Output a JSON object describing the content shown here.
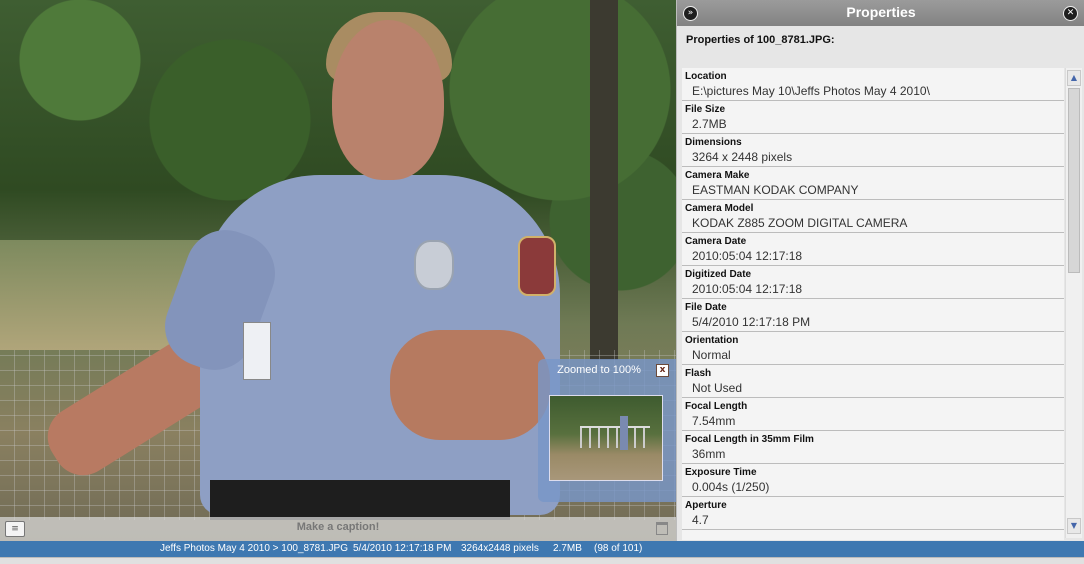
{
  "caption": {
    "placeholder": "Make a caption!"
  },
  "zoom": {
    "label": "Zoomed to 100%",
    "close": "x"
  },
  "panel": {
    "title": "Properties",
    "heading": "Properties of 100_8781.JPG:",
    "collapse_glyph": "»",
    "close_glyph": "✕",
    "properties": [
      {
        "label": "Location",
        "value": "E:\\pictures May 10\\Jeffs Photos May 4 2010\\"
      },
      {
        "label": "File Size",
        "value": "2.7MB"
      },
      {
        "label": "Dimensions",
        "value": "3264 x 2448 pixels"
      },
      {
        "label": "Camera Make",
        "value": "EASTMAN KODAK COMPANY"
      },
      {
        "label": "Camera Model",
        "value": "KODAK Z885 ZOOM DIGITAL CAMERA"
      },
      {
        "label": "Camera Date",
        "value": "2010:05:04 12:17:18"
      },
      {
        "label": "Digitized Date",
        "value": "2010:05:04 12:17:18"
      },
      {
        "label": "File Date",
        "value": "5/4/2010 12:17:18 PM"
      },
      {
        "label": "Orientation",
        "value": "Normal"
      },
      {
        "label": "Flash",
        "value": "Not Used"
      },
      {
        "label": "Focal Length",
        "value": "7.54mm"
      },
      {
        "label": "Focal Length in 35mm Film",
        "value": "36mm"
      },
      {
        "label": "Exposure Time",
        "value": "0.004s (1/250)"
      },
      {
        "label": "Aperture",
        "value": "4.7"
      }
    ]
  },
  "status": {
    "path": "Jeffs Photos May 4 2010 > 100_8781.JPG",
    "date": "5/4/2010 12:17:18 PM",
    "dimensions": "3264x2448 pixels",
    "size": "2.7MB",
    "position": "(98 of 101)"
  },
  "colors": {
    "status_bar": "#3e78b1",
    "panel_header": "#8c8c8c"
  }
}
